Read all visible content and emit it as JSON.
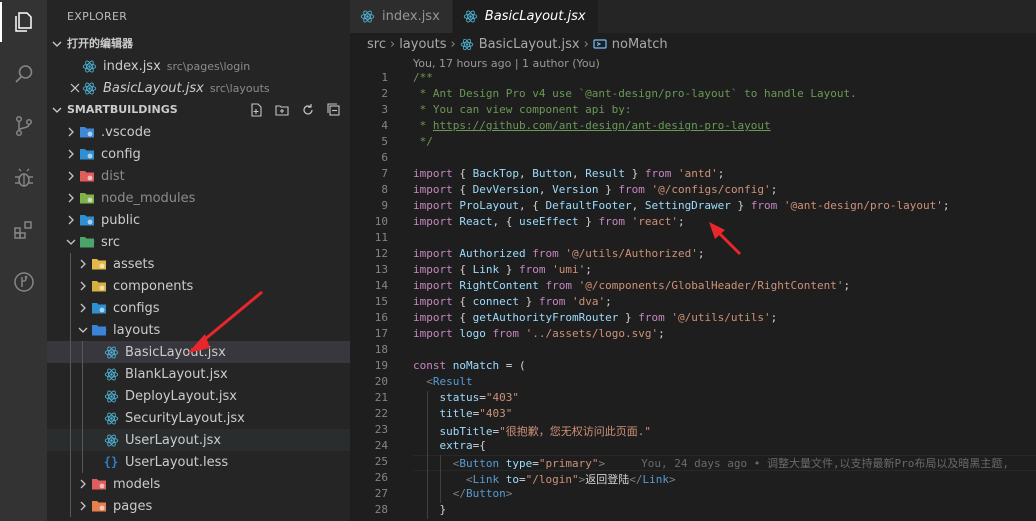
{
  "sidebar": {
    "title": "EXPLORER",
    "open_editors": {
      "header": "打开的编辑器",
      "items": [
        {
          "name": "index.jsx",
          "path": "src\\pages\\login"
        },
        {
          "name": "BasicLayout.jsx",
          "path": "src\\layouts"
        }
      ]
    },
    "project": {
      "header": "SMARTBUILDINGS",
      "tree": [
        {
          "label": ".vscode"
        },
        {
          "label": "config"
        },
        {
          "label": "dist"
        },
        {
          "label": "node_modules"
        },
        {
          "label": "public"
        },
        {
          "label": "src"
        },
        {
          "label": "assets"
        },
        {
          "label": "components"
        },
        {
          "label": "configs"
        },
        {
          "label": "layouts"
        },
        {
          "label": "BasicLayout.jsx"
        },
        {
          "label": "BlankLayout.jsx"
        },
        {
          "label": "DeployLayout.jsx"
        },
        {
          "label": "SecurityLayout.jsx"
        },
        {
          "label": "UserLayout.jsx"
        },
        {
          "label": "UserLayout.less"
        },
        {
          "label": "models"
        },
        {
          "label": "pages"
        }
      ]
    }
  },
  "tabs": [
    {
      "label": "index.jsx"
    },
    {
      "label": "BasicLayout.jsx"
    }
  ],
  "breadcrumb": [
    "src",
    "layouts",
    "BasicLayout.jsx",
    "noMatch"
  ],
  "editor": {
    "codelens": "You, 17 hours ago | 1 author (You)",
    "blame": "You, 24 days ago • 调整大量文件,以支持最新Pro布局以及暗黑主题,",
    "line_numbers": [
      "1",
      "2",
      "3",
      "4",
      "5",
      "6",
      "7",
      "8",
      "9",
      "10",
      "11",
      "12",
      "13",
      "14",
      "15",
      "16",
      "17",
      "18",
      "19",
      "20",
      "21",
      "22",
      "23",
      "24",
      "25",
      "26",
      "27",
      "28"
    ],
    "lines": [
      "/**",
      " * Ant Design Pro v4 use `@ant-design/pro-layout` to handle Layout.",
      " * You can view component api by:",
      " * https://github.com/ant-design/ant-design-pro-layout",
      " */",
      "",
      "import { BackTop, Button, Result } from 'antd';",
      "import { DevVersion, Version } from '@/configs/config';",
      "import ProLayout, { DefaultFooter, SettingDrawer } from '@ant-design/pro-layout';",
      "import React, { useEffect } from 'react';",
      "",
      "import Authorized from '@/utils/Authorized';",
      "import { Link } from 'umi';",
      "import RightContent from '@/components/GlobalHeader/RightContent';",
      "import { connect } from 'dva';",
      "import { getAuthorityFromRouter } from '@/utils/utils';",
      "import logo from '../assets/logo.svg';",
      "",
      "const noMatch = (",
      "  <Result",
      "    status=\"403\"",
      "    title=\"403\"",
      "    subTitle=\"很抱歉，您无权访问此页面.\"",
      "    extra={",
      "      <Button type=\"primary\">",
      "        <Link to=\"/login\">返回登陆</Link>",
      "      </Button>",
      "    }"
    ]
  },
  "colors": {
    "keyword": "#c586c0",
    "string": "#ce9178",
    "comment": "#6a9955",
    "variable": "#9cdcfe",
    "tag": "#569cd6",
    "react_icon": "#4fb6d9",
    "arrow": "#e8262b"
  }
}
